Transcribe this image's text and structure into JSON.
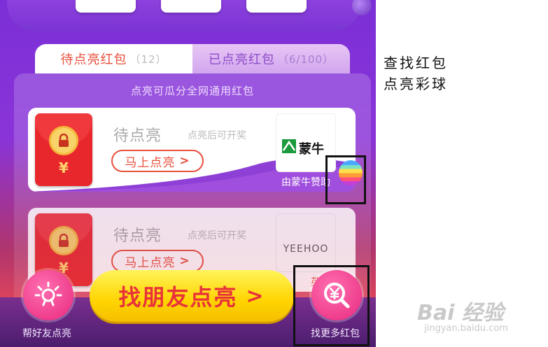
{
  "tabs": {
    "pending_label": "待点亮红包",
    "pending_count": "（12）",
    "lit_label": "已点亮红包",
    "lit_count": "（6/100）"
  },
  "panel": {
    "subtitle": "点亮可瓜分全网通用红包"
  },
  "cards": [
    {
      "status": "待点亮",
      "hint": "点亮后可开奖",
      "button_label": "马上点亮",
      "sponsor_text": "由蒙牛赞助",
      "sponsor_logo_text": "蒙牛",
      "currency": "¥"
    },
    {
      "status": "待点亮",
      "hint": "点亮后可开奖",
      "button_label": "马上点亮",
      "sponsor_text": "英氏",
      "sponsor_logo_text": "YEEHOO",
      "currency": "¥"
    }
  ],
  "bottom": {
    "left_label": "帮好友点亮",
    "main_button": "找朋友点亮",
    "right_label": "找更多红包"
  },
  "annotations": {
    "line1": "查找红包",
    "line2": "点亮彩球"
  },
  "watermark": {
    "brand": "Bai 经验",
    "url": "jingyan.baidu.com"
  },
  "colors": {
    "accent_red": "#e8503d",
    "button_yellow": "#ffd400",
    "pink": "#e8287e"
  }
}
